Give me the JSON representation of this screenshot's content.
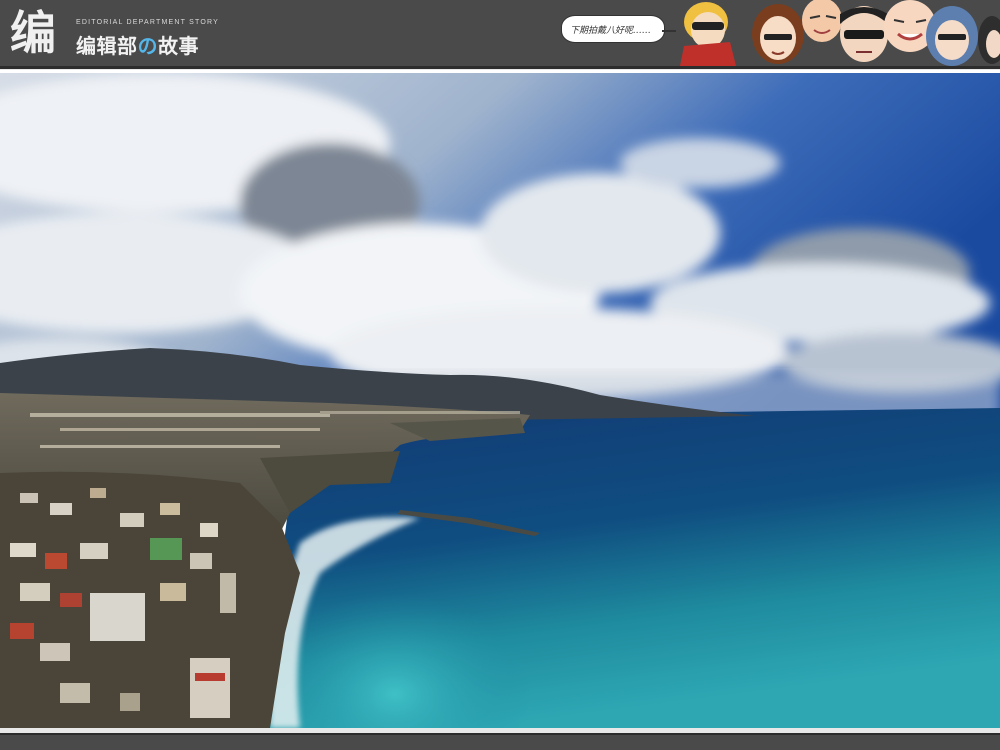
{
  "header": {
    "logo_mark": "编",
    "tagline": "EDITORIAL DEPARTMENT STORY",
    "title_part1": "编辑部",
    "title_part2": "の",
    "title_part3": "故事",
    "speech_text": "下期拍戴八好呢……",
    "characters": [
      "character-blonde-sunglasses-icon",
      "character-brown-hair-girl-icon",
      "character-bald-man-icon",
      "character-sunglasses-man-icon",
      "character-round-face-man-icon",
      "character-blue-hair-girl-icon"
    ]
  },
  "photo": {
    "subject": "coastal-town-cliff-sea-view",
    "colors": {
      "sky_top": "#1d4fa3",
      "clouds": "#e8ecf1",
      "sea_deep": "#0b2f63",
      "sea_turquoise": "#2aa3b3",
      "hills": "#3a4148"
    }
  }
}
